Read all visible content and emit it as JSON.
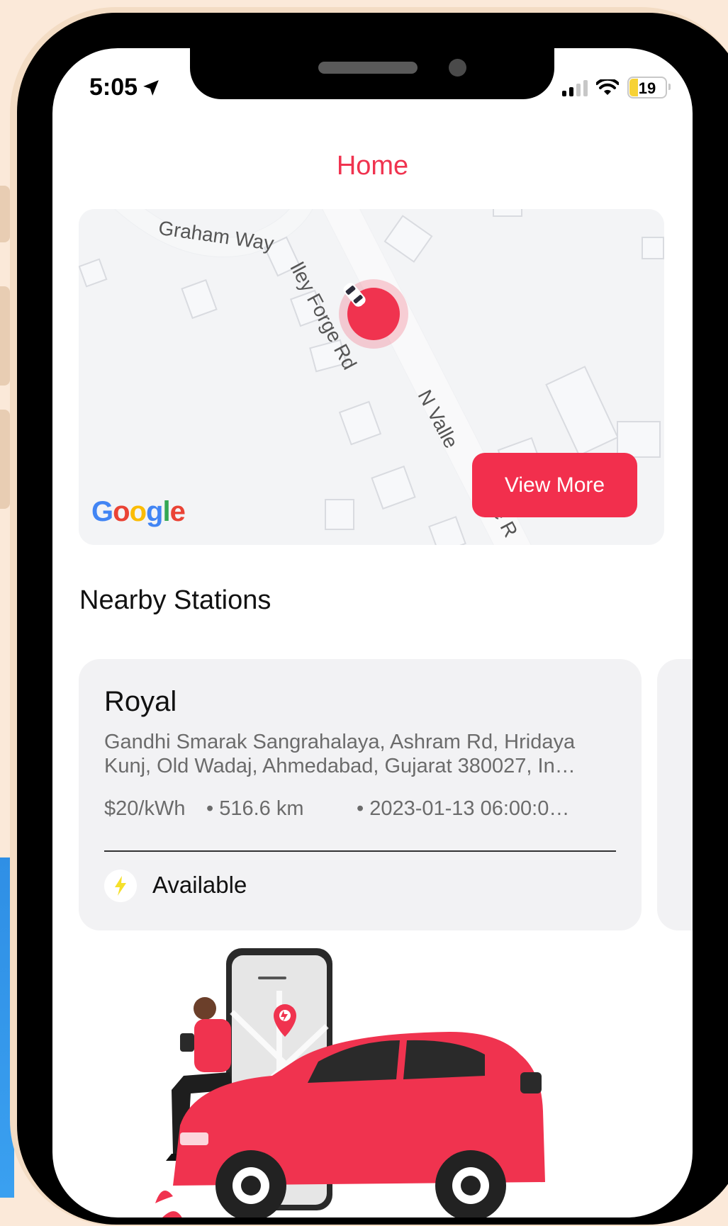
{
  "status_bar": {
    "time": "5:05",
    "battery": "19"
  },
  "header": {
    "title": "Home"
  },
  "map": {
    "streets": [
      "Graham Way",
      "lley Forge Rd",
      "N Valle",
      "e R"
    ],
    "attribution": [
      "G",
      "o",
      "o",
      "g",
      "l",
      "e"
    ],
    "view_more_label": "View More"
  },
  "nearby": {
    "section_title": "Nearby Stations",
    "stations": [
      {
        "name": "Royal",
        "address": "Gandhi Smarak Sangrahalaya, Ashram Rd, Hridaya Kunj, Old Wadaj, Ahmedabad, Gujarat 380027, In…",
        "price": "$20/kWh",
        "distance": "• 516.6 km",
        "datetime": "• 2023-01-13 06:00:0…",
        "status": "Available"
      }
    ]
  },
  "colors": {
    "accent": "#f0334f",
    "bolt": "#f5e02a",
    "google_blue": "#4285F4",
    "google_red": "#EA4335",
    "google_yellow": "#FBBC05",
    "google_green": "#34A853"
  }
}
